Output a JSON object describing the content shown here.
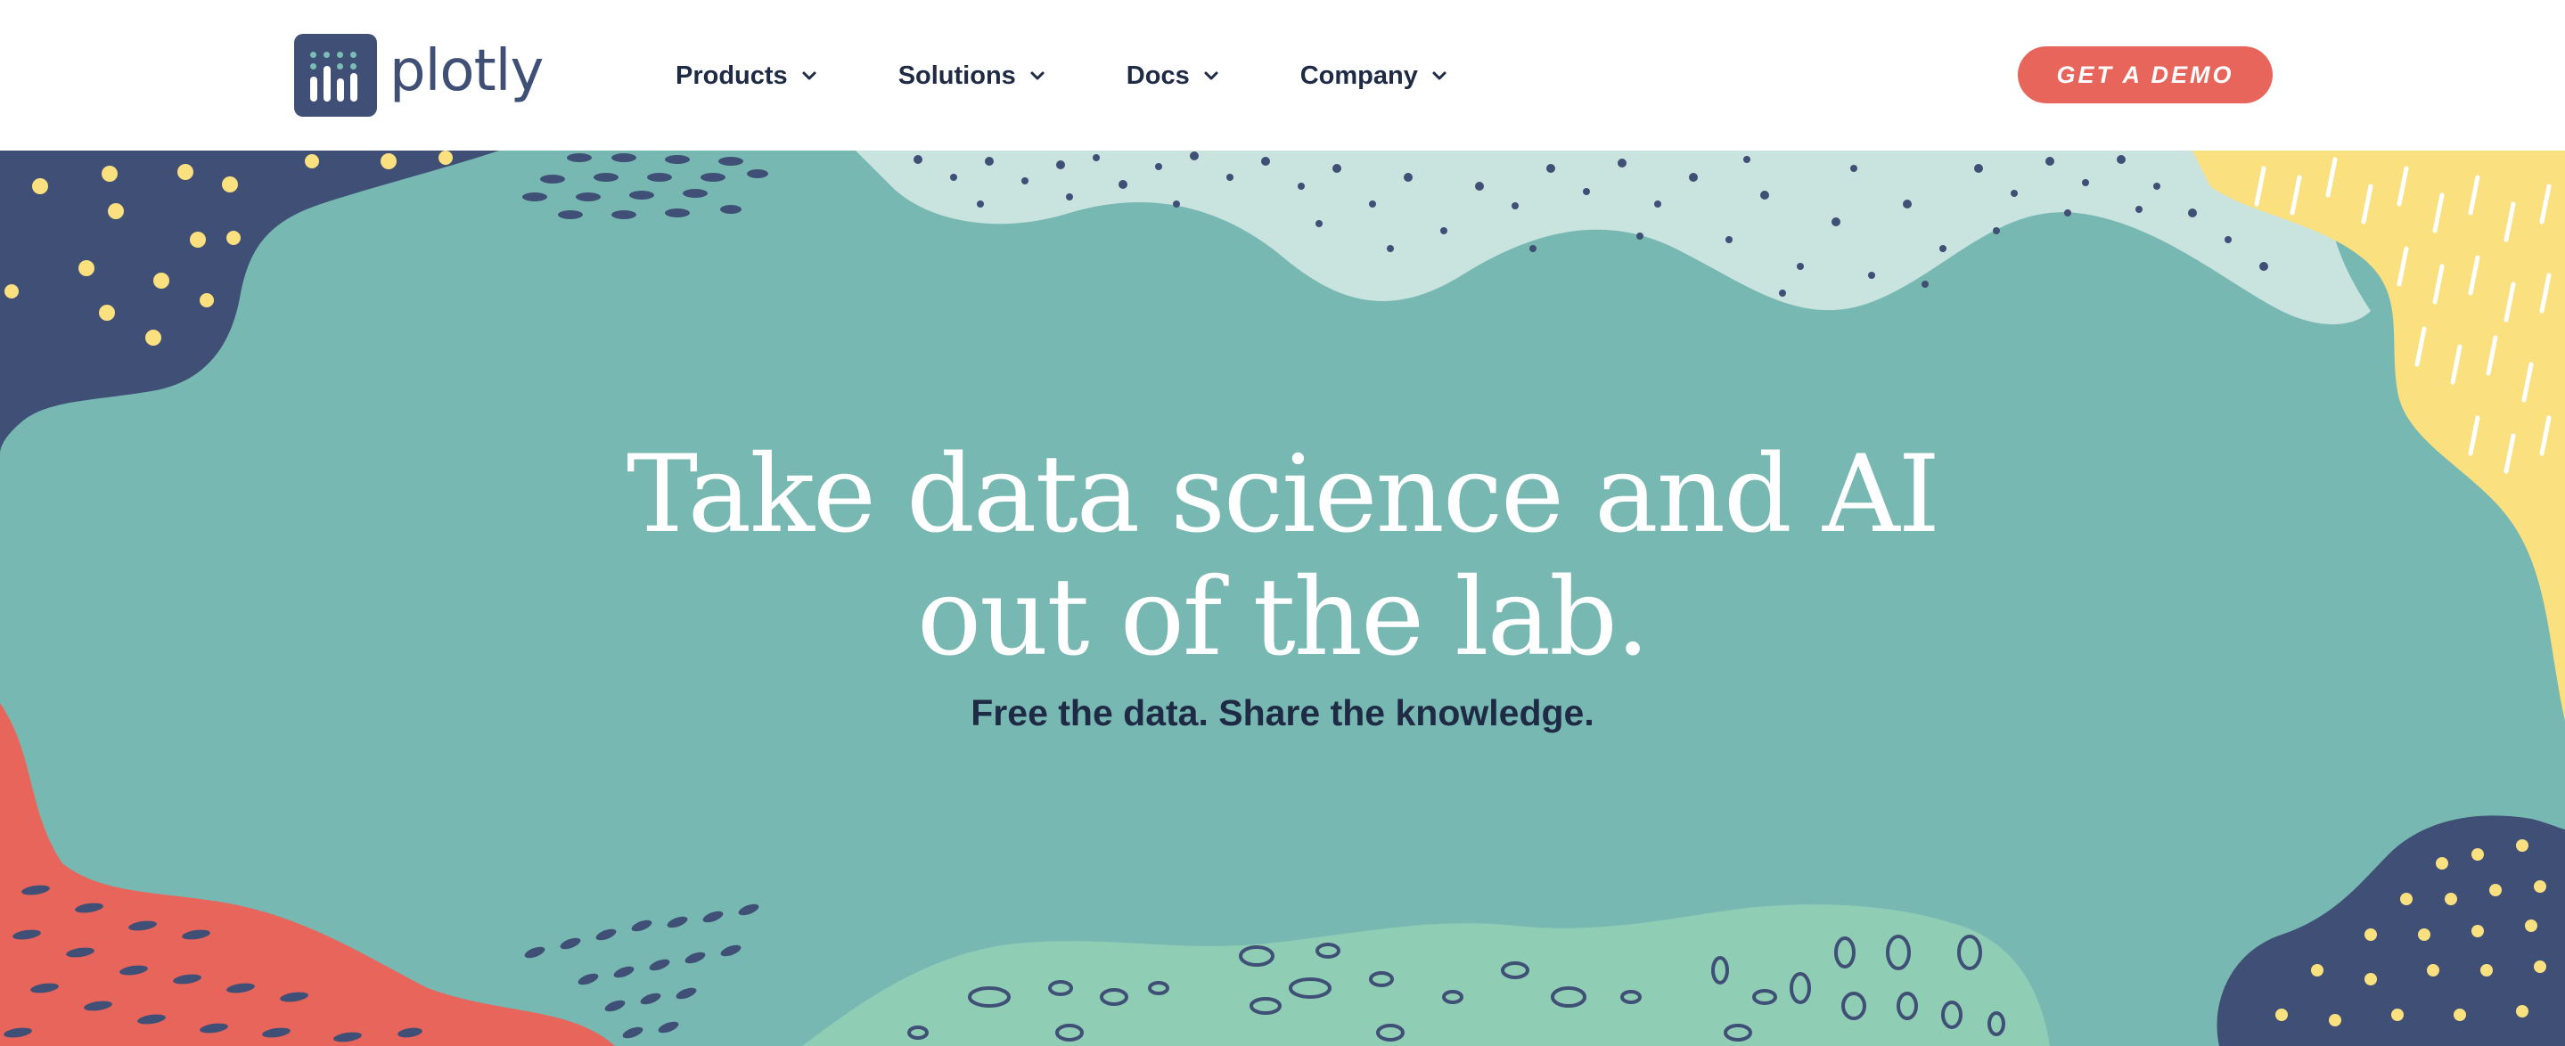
{
  "brand": {
    "name": "plotly",
    "colors": {
      "navy": "#3f4f75",
      "teal": "#78b8b2",
      "coral": "#e8655b",
      "yellow": "#fbe080",
      "mint": "#8fcdb5",
      "pale": "#c9e3df"
    }
  },
  "nav": {
    "items": [
      {
        "label": "Products",
        "icon": "chevron-down-icon"
      },
      {
        "label": "Solutions",
        "icon": "chevron-down-icon"
      },
      {
        "label": "Docs",
        "icon": "chevron-down-icon"
      },
      {
        "label": "Company",
        "icon": "chevron-down-icon"
      }
    ]
  },
  "cta": {
    "label": "GET A DEMO"
  },
  "hero": {
    "title_line1": "Take data science and AI",
    "title_line2": "out of the lab.",
    "subtitle": "Free the data. Share the knowledge."
  }
}
